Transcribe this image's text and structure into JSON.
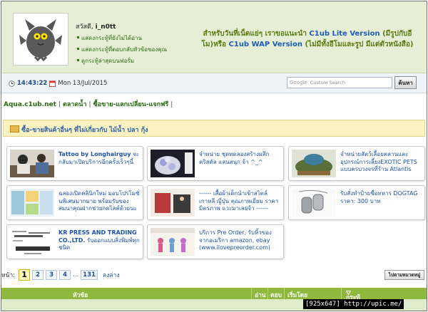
{
  "header": {
    "greeting": "สวัสดี,",
    "username": "i_n0tt",
    "user_links": [
      "แสดงกระทู้ที่ยังไม่ได้อ่าน",
      "แสดงกระทู้ที่ตอบกลับหัวข้อของคุณ",
      "ดูกระทู้ล่าสุดบนฟอรั่ม"
    ],
    "promo_line1_a": "สำหรับวันที่เน็ตแย่ๆ เราขอแนะนำ ",
    "promo_link1": "C1ub Lite Version",
    "promo_line1_b": " (มีรูปกับอีโม)หรือ ",
    "promo_link2": "C1ub WAP Version",
    "promo_line1_c": " (ไม่มีทั้งอีโมและรูป มีแต่ตัวหนังสือ)"
  },
  "toolbar": {
    "time": "14:43:22",
    "date": "Mon 13/Jul/2015",
    "search_brand": "Google",
    "search_placeholder": "Custom Search",
    "search_button": "ค้นหา"
  },
  "breadcrumb": [
    "Aqua.c1ub.net",
    "ตลาดน้ำ",
    "ซื้อขาย-แลกเปลี่ยน-แจกฟรี"
  ],
  "category": {
    "title": "ซื้อ-ขายสินค้าอื่นๆ ที่ไม่เกี่ยวกับ ไม้น้ำ ปลา กุ้ง"
  },
  "cards": [
    {
      "bold": "Tattoo by Longhairguy",
      "text": " จะกลับมาเปิดบริการอีกครั้งเร็วๆนี้",
      "thumb": "tattoo-photo"
    },
    {
      "bold": "",
      "text": "จำหน่าย ชุดทดลองสร้างผลึกคริสตัล แสนสนุก จ้า ^_^",
      "thumb": "crystal-kit-photo"
    },
    {
      "bold": "",
      "text": "จำหน่ายสัตว์เลื้อยคลานและอุปกรณ์การเลี้ยงEXOTIC PETS แบบครบวงจรที่ร้าน Atlantis",
      "thumb": "reptile-photo"
    },
    {
      "bold": "",
      "text": "ฉลองเปิดคลินิกใหม่ มอบโปรโมชั่นพิเศษมากมาย พร้อมรับของสมนาคุณฝากช่วยกดไลค์ด้วยนะ",
      "thumb": "clinic-photo"
    },
    {
      "bold": "",
      "text": "------ เสื้อผ้าเด็กนำเข้าสไตล์เกาหลี ญี่ปุ่น คุณภาพเยี่ยม ราคามิตรภาพ แวะมาเลยจ้า ------",
      "thumb": "kids-clothes-photo"
    },
    {
      "bold": "",
      "text": "รับสั่งทำป้ายชื่อทหาร DOGTAG ราคา: 300 บาท",
      "thumb": "dogtag-photo"
    },
    {
      "bold": "KR PRESS AND TRADING CO.,LTD.",
      "text": " รับออกแบบสิ่งพิมพ์ทุกชนิด",
      "thumb": "publishing-wordcloud"
    },
    {
      "bold": "",
      "text": "บริการ Pre Order, รับหิ้วของจากอเมริกา amazon, ebay (www.ilovepreorder.com)",
      "thumb": "preorder-banner"
    }
  ],
  "pagination": {
    "label": "หน้า:",
    "pages": [
      "1",
      "2",
      "3",
      "4"
    ],
    "dots": "...",
    "last_page": "131",
    "next": "ลงล่าง",
    "jump_button": "ไปตามหมวดหมู่"
  },
  "table": {
    "columns": [
      "หัวข้อ",
      "อ่าน",
      "ตอบ",
      "เริ่มโดย",
      "กระทู้ล่าสุด"
    ]
  },
  "watermark": "[925x647] http://upic.me/",
  "colors": {
    "header_bg": "#e6efd6",
    "table_header": "#8fb83e",
    "link": "#1c52a8",
    "category_bar": "#fbf2c2"
  }
}
